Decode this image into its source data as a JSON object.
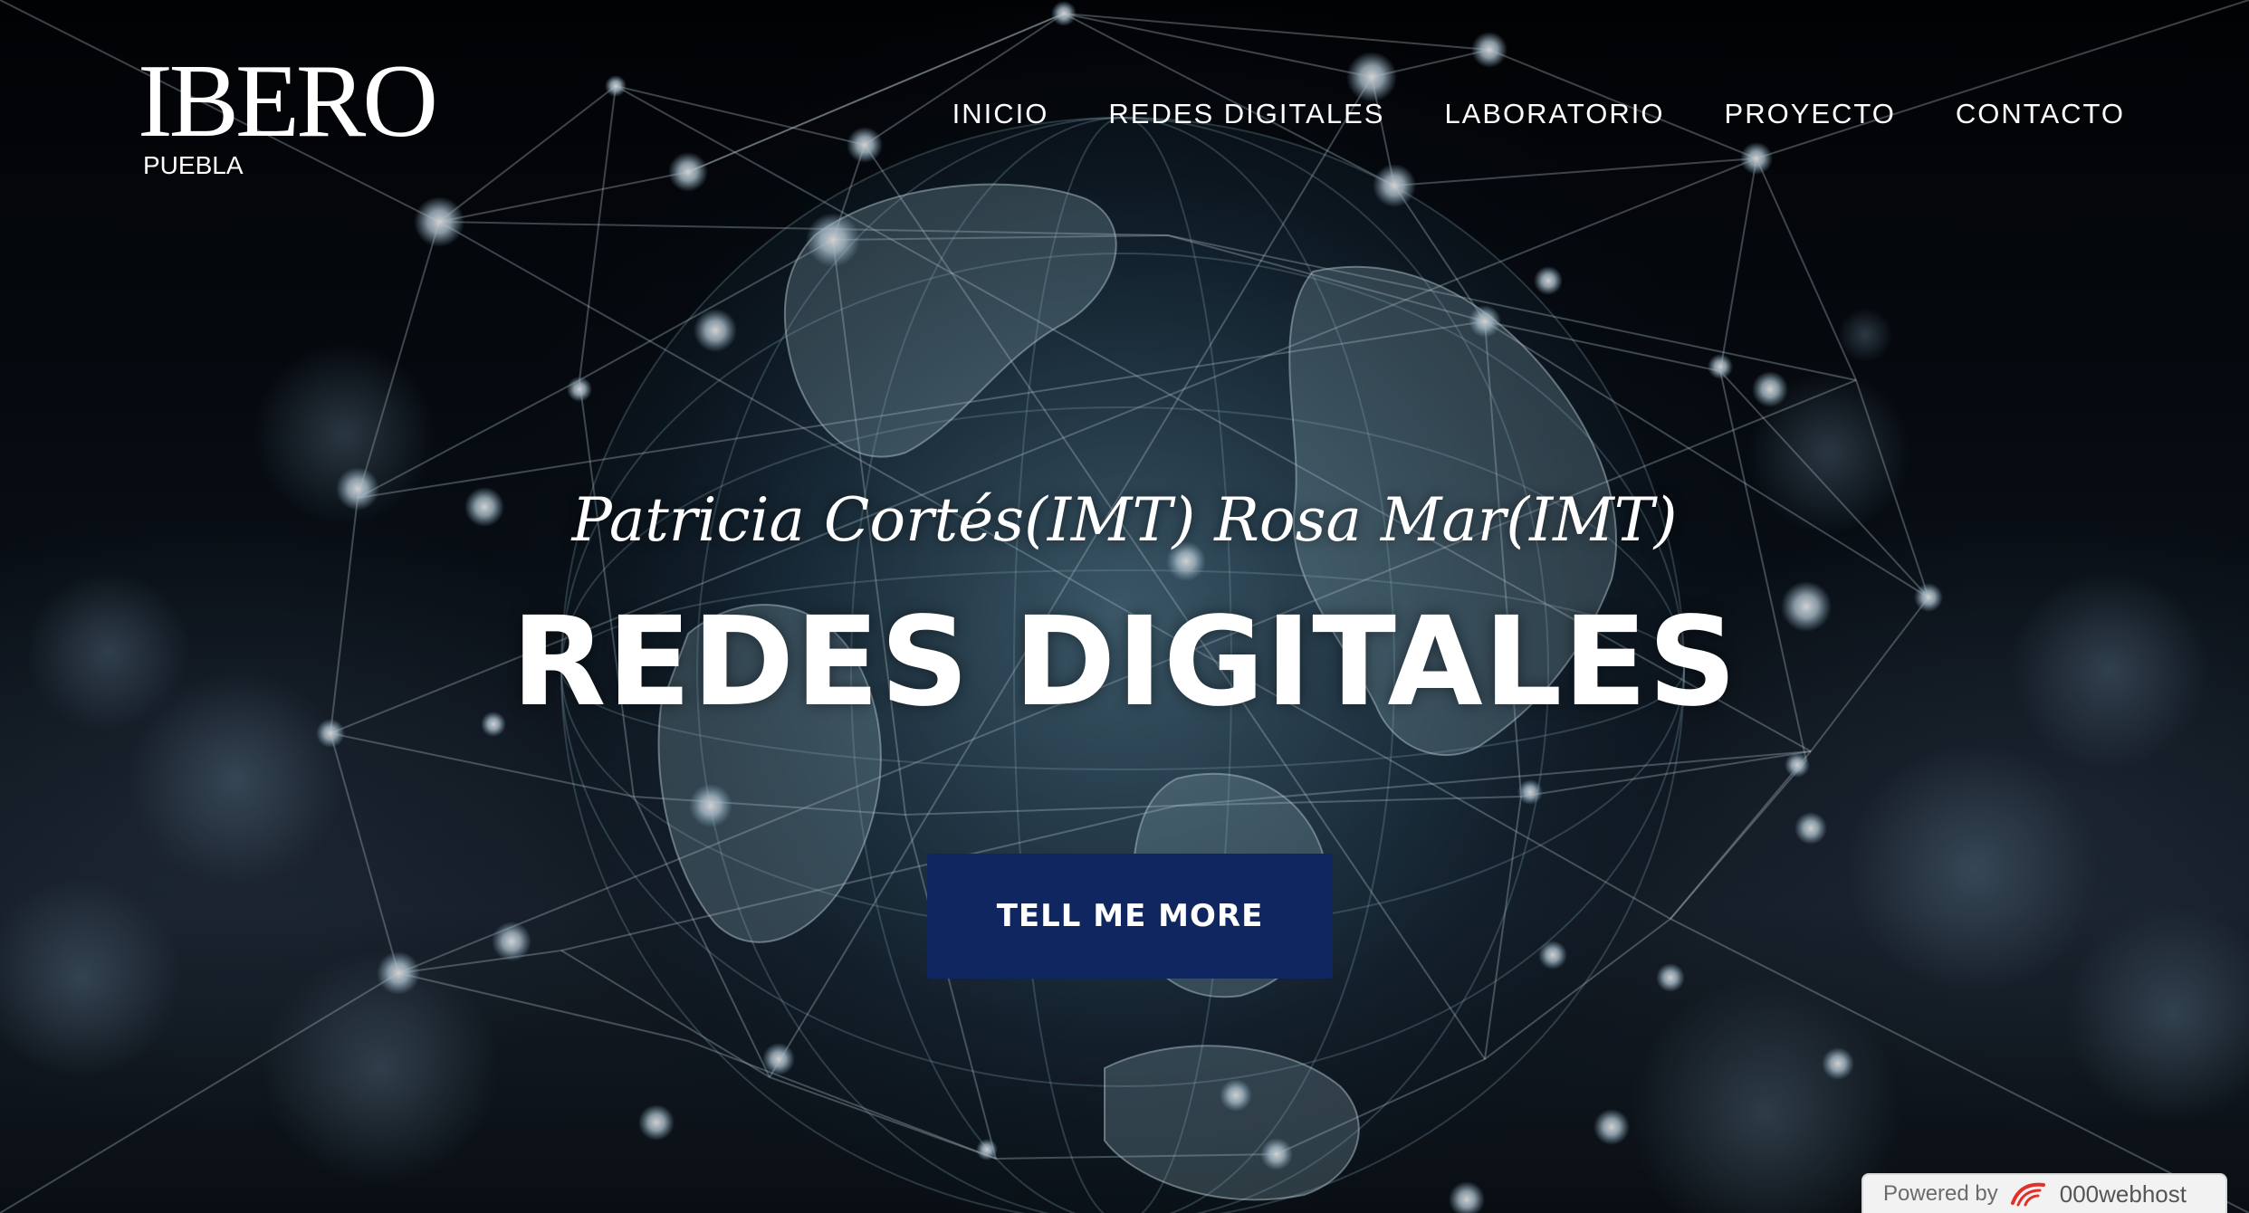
{
  "logo": {
    "main": "IBERO",
    "sub": "PUEBLA"
  },
  "nav": {
    "items": [
      {
        "label": "INICIO"
      },
      {
        "label": "REDES DIGITALES"
      },
      {
        "label": "LABORATORIO"
      },
      {
        "label": "PROYECTO"
      },
      {
        "label": "CONTACTO"
      }
    ]
  },
  "hero": {
    "subtitle": "Patricia Cortés(IMT) Rosa Mar(IMT)",
    "title": "REDES DIGITALES",
    "cta_label": "TELL ME MORE"
  },
  "footer_badge": {
    "powered_by": "Powered by",
    "brand": "000webhost"
  },
  "colors": {
    "cta_background": "#0f2660",
    "text": "#ffffff"
  },
  "icons": {
    "badge": "000webhost-logo-icon"
  }
}
